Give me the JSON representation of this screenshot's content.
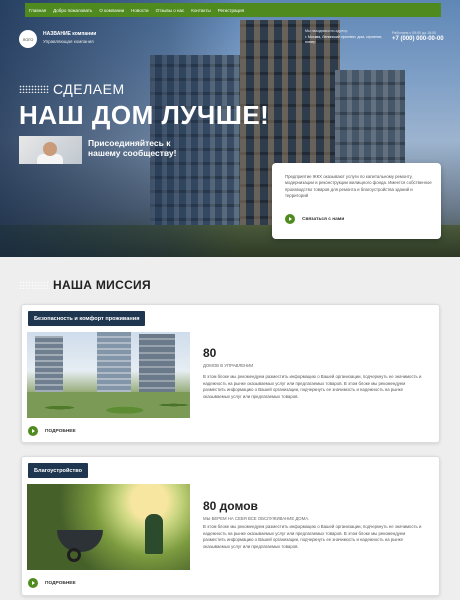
{
  "nav": {
    "items": [
      "Главная",
      "Добро пожаловать",
      "О компании",
      "Новости",
      "Отзывы о нас",
      "Контакты",
      "Регистрация"
    ]
  },
  "header": {
    "logo_text": "ЛОГО",
    "brand_name": "НАЗВАНИЕ компании",
    "brand_subtitle": "Управляющая компания",
    "address_label": "Мы находимся по адресу:",
    "address": "г. Москва, Ленинский проспект, дом, строение, номер",
    "phone_label": "Работаем с 09:00 до 18:00",
    "phone": "+7 (000) 000-00-00"
  },
  "hero": {
    "kicker": "СДЕЛАЕМ",
    "title": "НАШ ДОМ ЛУЧШЕ!",
    "join_text": "Присоединяйтесь к нашему сообществу!",
    "card_text": "Предприятие ЖКХ оказывают услуги по капитальному ремонту, модернизации и реконструкции жилищного фонда. Имеется собственное производство товаров для ремонта и благоустройства зданий и территорий",
    "card_button": "Связаться с нами"
  },
  "mission": {
    "title": "НАША МИССИЯ",
    "cards": [
      {
        "tag": "Безопасность и комфорт проживания",
        "number": "80",
        "caption": "ДОМОВ В УПРАВЛЕНИИ",
        "description": "В этом блоке мы рекомендуем разместить информацию о Вашей организации, подчеркнуть ее значимость и надежность на рынке оказываемых услуг или предлагаемых товаров. В этом блоке мы рекомендуем разместить информацию о Вашей организации, подчеркнуть ее значимость и надежность на рынке оказываемых услуг или предлагаемых товаров.",
        "button": "ПОДРОБНЕЕ"
      },
      {
        "tag": "Благоустройство",
        "number": "80 домов",
        "caption": "МЫ БЕРЕМ НА СЕБЯ ВСЕ ОБСЛУЖИВАНИЕ ДОМА.",
        "description": "В этом блоке мы рекомендуем разместить информацию о Вашей организации, подчеркнуть ее значимость и надежность на рынке оказываемых услуг или предлагаемых товаров. В этом блоке мы рекомендуем разместить информацию о Вашей организации, подчеркнуть ее значимость и надежность на рынке оказываемых услуг или предлагаемых товаров.",
        "button": "ПОДРОБНЕЕ"
      }
    ]
  },
  "colors": {
    "nav_green": "#4f8a1e",
    "tag_navy": "#1f3650",
    "page_bg": "#eeeeee"
  }
}
